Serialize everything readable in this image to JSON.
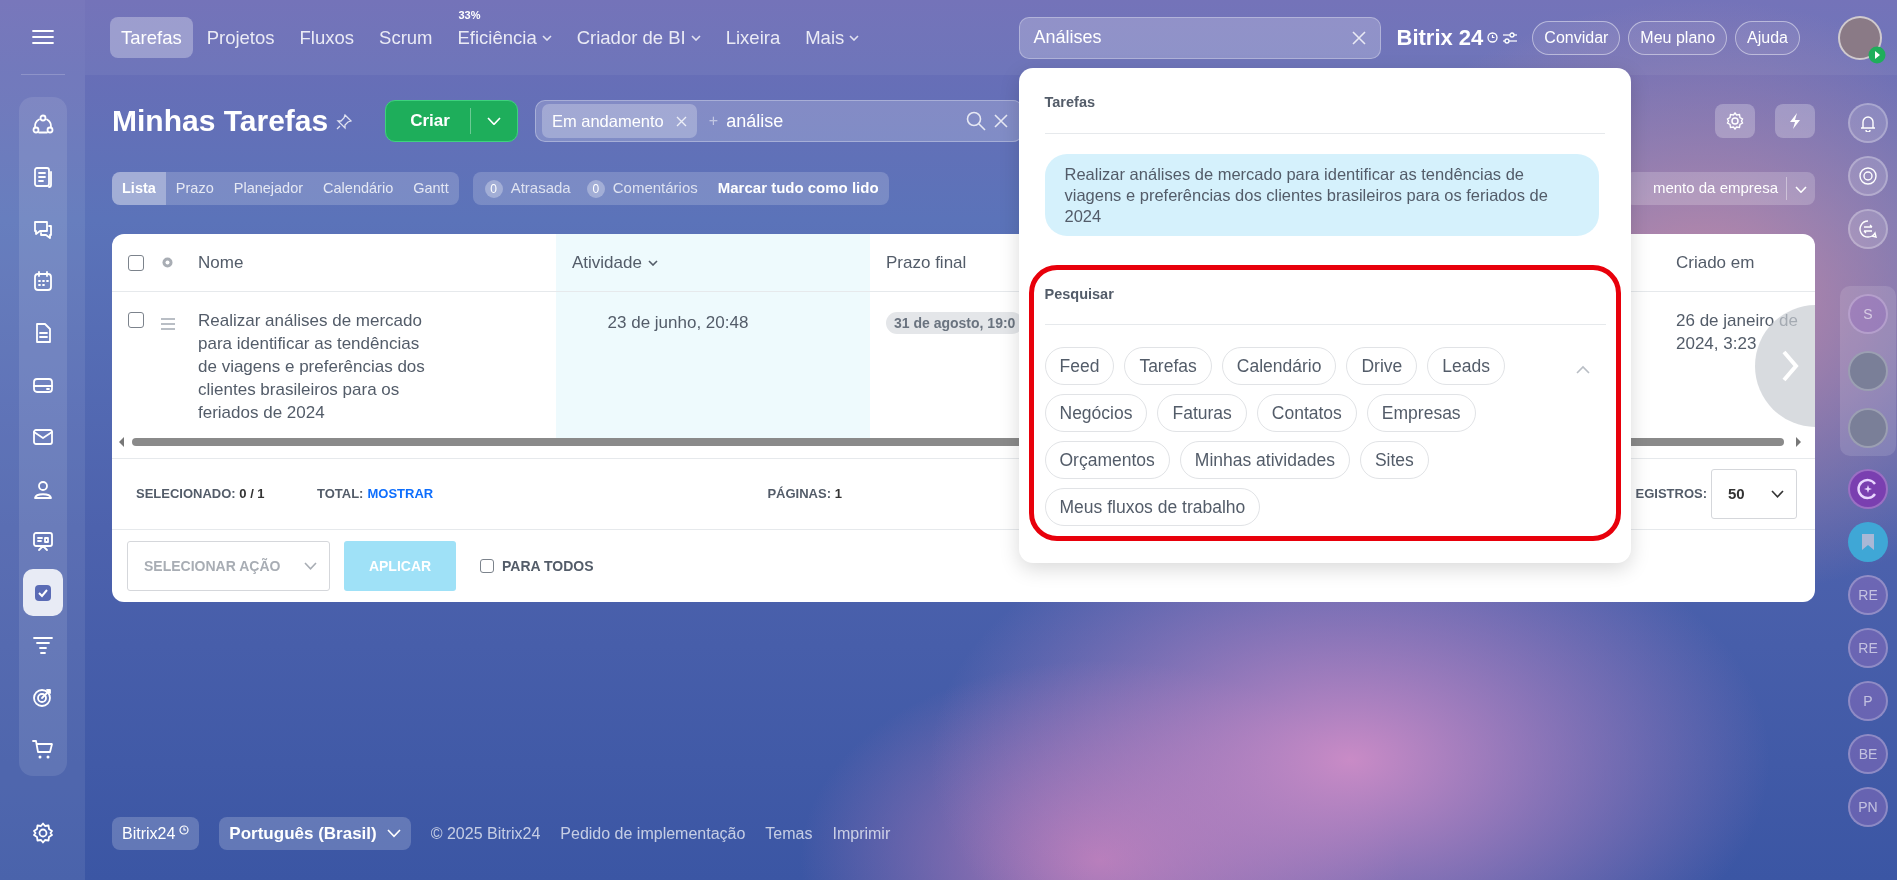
{
  "sidebar": {
    "items": [
      {
        "selected": false
      },
      {
        "selected": false
      },
      {
        "selected": false
      },
      {
        "selected": false
      },
      {
        "selected": false
      },
      {
        "selected": false
      },
      {
        "selected": false
      },
      {
        "selected": false
      },
      {
        "selected": false
      },
      {
        "selected": true
      },
      {
        "selected": false
      },
      {
        "selected": false
      },
      {
        "selected": false
      }
    ]
  },
  "top_nav": {
    "tabs": [
      {
        "label": "Tarefas",
        "selected": true,
        "dropdown": false
      },
      {
        "label": "Projetos",
        "selected": false,
        "dropdown": false
      },
      {
        "label": "Fluxos",
        "selected": false,
        "dropdown": false
      },
      {
        "label": "Scrum",
        "selected": false,
        "dropdown": false
      },
      {
        "label": "Eficiência",
        "selected": false,
        "dropdown": true,
        "badge": "33%"
      },
      {
        "label": "Criador de BI",
        "selected": false,
        "dropdown": true
      },
      {
        "label": "Lixeira",
        "selected": false,
        "dropdown": false
      },
      {
        "label": "Mais",
        "selected": false,
        "dropdown": true
      }
    ]
  },
  "global_search": {
    "value": "Análises"
  },
  "logo": {
    "text": "Bitrix",
    "number": "24"
  },
  "header_buttons": [
    {
      "label": "Convidar"
    },
    {
      "label": "Meu plano"
    },
    {
      "label": "Ajuda"
    }
  ],
  "page": {
    "title": "Minhas Tarefas",
    "create_button": "Criar",
    "filter": {
      "tag": "Em andamento",
      "add_sign": "+",
      "query": "análise"
    },
    "view_tabs": [
      {
        "label": "Lista",
        "selected": true
      },
      {
        "label": "Prazo",
        "selected": false
      },
      {
        "label": "Planejador",
        "selected": false
      },
      {
        "label": "Calendário",
        "selected": false
      },
      {
        "label": "Gantt",
        "selected": false
      }
    ],
    "counters": [
      {
        "count": "0",
        "label": "Atrasada"
      },
      {
        "count": "0",
        "label": "Comentários"
      }
    ],
    "mark_all_read": "Marcar tudo como lido",
    "preset_button": "mento da empresa"
  },
  "table": {
    "select_all_checked": false,
    "columns": [
      {
        "label": "Nome",
        "sorted": false
      },
      {
        "label": "Atividade",
        "sorted": true
      },
      {
        "label": "Prazo final",
        "sorted": false
      },
      {
        "label": "Criado em",
        "sorted": false
      }
    ],
    "rows": [
      {
        "checked": false,
        "name": "Realizar análises de mercado para identificar as tendências de viagens e preferências dos clientes brasileiros para os feriados de 2024",
        "activity": "23 de junho, 20:48",
        "deadline": "31 de agosto, 19:0",
        "created": "26 de janeiro de 2024, 3:23"
      }
    ],
    "summary": {
      "selected_label": "SELECIONADO:",
      "selected_value": "0 / 1",
      "total_label": "TOTAL:",
      "total_link": "MOSTRAR",
      "pages_label": "PÁGINAS:",
      "pages_value": "1",
      "records_label": "EGISTROS:",
      "records_value": "50"
    },
    "actions": {
      "select_placeholder": "SELECIONAR AÇÃO",
      "apply_button": "APLICAR",
      "apply_disabled": true,
      "for_all_label": "PARA TODOS",
      "for_all_checked": false
    }
  },
  "search_dropdown": {
    "section_title": "Tarefas",
    "result": "Realizar análises de mercado para identificar as tendências de viagens e preferências dos clientes brasileiros para os feriados de 2024",
    "search_title": "Pesquisar",
    "chips": [
      "Feed",
      "Tarefas",
      "Calendário",
      "Drive",
      "Leads",
      "Negócios",
      "Faturas",
      "Contatos",
      "Empresas",
      "Orçamentos",
      "Minhas atividades",
      "Sites",
      "Meus fluxos de trabalho"
    ]
  },
  "right_rail": {
    "pinned": [
      {
        "kind": "initials",
        "initials": "S"
      },
      {
        "kind": "photo"
      },
      {
        "kind": "photo"
      }
    ],
    "recent": [
      {
        "initials": "RE"
      },
      {
        "initials": "RE"
      },
      {
        "initials": "P"
      },
      {
        "initials": "BE"
      },
      {
        "initials": "PN"
      }
    ]
  },
  "footer": {
    "brand": "Bitrix24",
    "language": "Português (Brasil)",
    "copyright": "© 2025 Bitrix24",
    "links": [
      "Pedido de implementação",
      "Temas",
      "Imprimir"
    ]
  }
}
